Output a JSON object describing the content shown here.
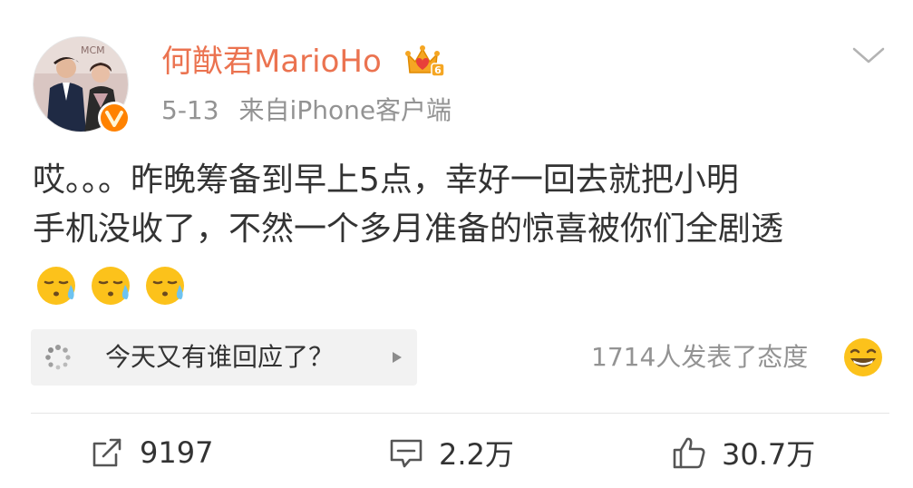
{
  "post": {
    "username": "何猷君MarioHo",
    "date": "5-13",
    "source": "来自iPhone客户端",
    "content_line1": "哎。。。昨晚筹备到早上5点，幸好一回去就把小明",
    "content_line2": "手机没收了，不然一个多月准备的惊喜被你们全剧透",
    "emoji_icons": [
      "sweat-sleepy-emoji",
      "sweat-sleepy-emoji",
      "sweat-sleepy-emoji"
    ],
    "avatar_sign_text": "MCM"
  },
  "topic": {
    "text": "今天又有谁回应了？",
    "icon": "loading-spinner-icon"
  },
  "reactions": {
    "text": "1714人发表了态度",
    "icon": "laughing-emoji"
  },
  "actions": {
    "repost_count": "9197",
    "comment_count": "2.2万",
    "like_count": "30.7万"
  },
  "colors": {
    "username": "#eb7350",
    "meta": "#939393",
    "text": "#333333",
    "card_bg": "#f2f2f2",
    "verified_badge": "#ff8200",
    "emoji_yellow": "#fcc21b"
  }
}
